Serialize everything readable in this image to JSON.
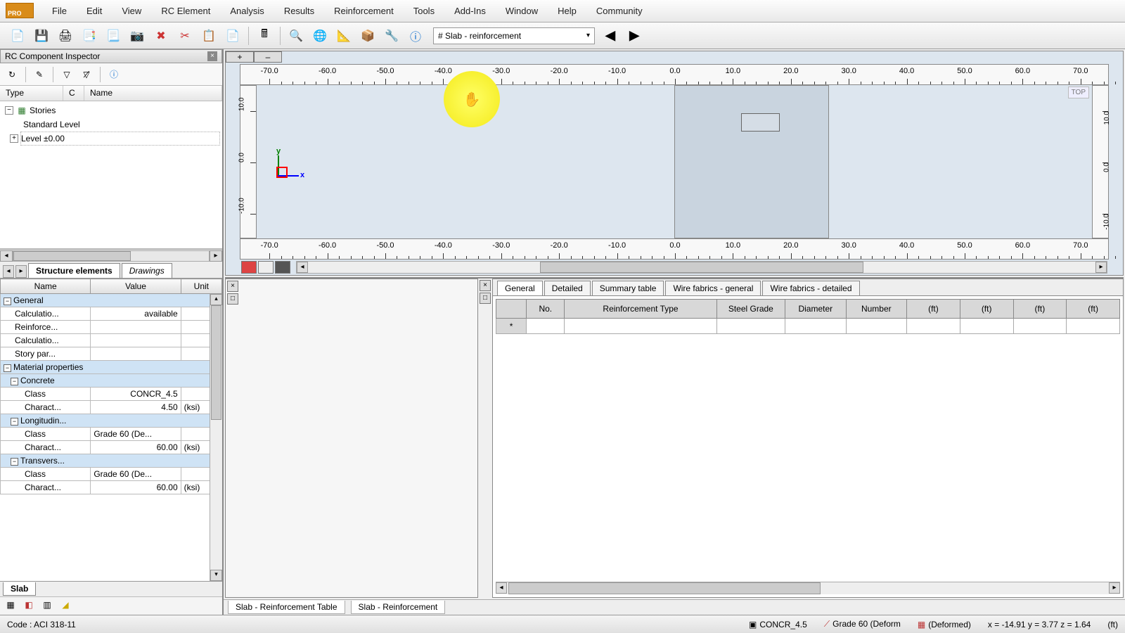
{
  "logo": "PRO",
  "menu": [
    "File",
    "Edit",
    "View",
    "RC Element",
    "Analysis",
    "Results",
    "Reinforcement",
    "Tools",
    "Add-Ins",
    "Window",
    "Help",
    "Community"
  ],
  "toolbar_dropdown": {
    "icon": "#",
    "label": "Slab - reinforcement"
  },
  "inspector": {
    "title": "RC Component Inspector",
    "headers": {
      "type": "Type",
      "c": "C",
      "name": "Name"
    },
    "tree": {
      "root": "Stories",
      "child1": "Standard Level",
      "child2": "Level ±0.00"
    }
  },
  "struct_tabs": {
    "a": "Structure elements",
    "b": "Drawings"
  },
  "prop_headers": {
    "name": "Name",
    "value": "Value",
    "unit": "Unit"
  },
  "props": {
    "g1": "General",
    "r1n": "Calculatio...",
    "r1v": "available",
    "r2n": "Reinforce...",
    "r3n": "Calculatio...",
    "r4n": "Story par...",
    "g2": "Material properties",
    "sg1": "Concrete",
    "c1n": "Class",
    "c1v": "CONCR_4.5",
    "c2n": "Charact...",
    "c2v": "4.50",
    "c2u": "(ksi)",
    "sg2": "Longitudin...",
    "l1n": "Class",
    "l1v": "Grade 60 (De...",
    "l2n": "Charact...",
    "l2v": "60.00",
    "l2u": "(ksi)",
    "sg3": "Transvers...",
    "t1n": "Class",
    "t1v": "Grade 60 (De...",
    "t2n": "Charact...",
    "t2v": "60.00",
    "t2u": "(ksi)"
  },
  "slab_tab": "Slab",
  "viewport": {
    "top_badge": "TOP",
    "h_ticks": [
      "-70.0",
      "-60.0",
      "-50.0",
      "-40.0",
      "-30.0",
      "-20.0",
      "-10.0",
      "0.0",
      "10.0",
      "20.0",
      "30.0",
      "40.0",
      "50.0",
      "60.0",
      "70.0"
    ],
    "v_ticks": [
      "10.0",
      "0.0",
      "-10.0"
    ],
    "axis_x": "x",
    "axis_y": "y",
    "vt_plus": "+",
    "vt_minus": "–"
  },
  "reinf_tabs": [
    "General",
    "Detailed",
    "Summary table",
    "Wire fabrics - general",
    "Wire fabrics - detailed"
  ],
  "reinf_cols": [
    "",
    "No.",
    "Reinforcement Type",
    "Steel Grade",
    "Diameter",
    "Number",
    "(ft)",
    "(ft)",
    "(ft)",
    "(ft)"
  ],
  "reinf_rowmark": "*",
  "doc_tabs": [
    "Slab - Reinforcement Table",
    "Slab - Reinforcement"
  ],
  "status": {
    "code": "Code : ACI 318-11",
    "concr": "CONCR_4.5",
    "grade": "Grade 60 (Deform",
    "deform": "(Deformed)",
    "coords": "x = -14.91 y = 3.77 z = 1.64",
    "unit": "(ft)"
  }
}
